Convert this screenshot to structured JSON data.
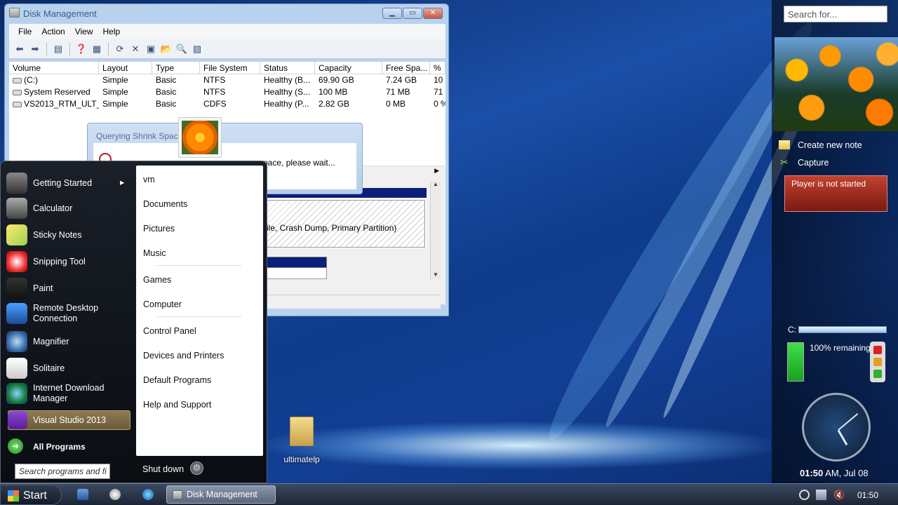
{
  "disk_management": {
    "title": "Disk Management",
    "controls": {
      "minimize": "▁",
      "maximize": "▭",
      "close": "✕"
    },
    "menu": [
      "File",
      "Action",
      "View",
      "Help"
    ],
    "columns": [
      "Volume",
      "Layout",
      "Type",
      "File System",
      "Status",
      "Capacity",
      "Free Spa...",
      "%"
    ],
    "rows": [
      {
        "volume": "(C:)",
        "layout": "Simple",
        "type": "Basic",
        "fs": "NTFS",
        "status": "Healthy (B...",
        "capacity": "69.90 GB",
        "free": "7.24 GB",
        "pct": "10"
      },
      {
        "volume": "System Reserved",
        "layout": "Simple",
        "type": "Basic",
        "fs": "NTFS",
        "status": "Healthy (S...",
        "capacity": "100 MB",
        "free": "71 MB",
        "pct": "71"
      },
      {
        "volume": "VS2013_RTM_ULT_...",
        "layout": "Simple",
        "type": "Basic",
        "fs": "CDFS",
        "status": "Healthy (P...",
        "capacity": "2.82 GB",
        "free": "0 MB",
        "pct": "0 %"
      }
    ],
    "partition_text": "ile, Crash Dump, Primary Partition)"
  },
  "shrink_dialog": {
    "title": "Querying Shrink Space",
    "message": "pace, please wait..."
  },
  "start_menu": {
    "programs": [
      {
        "label": "Getting Started",
        "arrow": "▸"
      },
      {
        "label": "Calculator"
      },
      {
        "label": "Sticky Notes"
      },
      {
        "label": "Snipping Tool"
      },
      {
        "label": "Paint"
      },
      {
        "label": "Remote Desktop",
        "label2": "Connection"
      },
      {
        "label": "Magnifier"
      },
      {
        "label": "Solitaire"
      },
      {
        "label": "Internet Download",
        "label2": "Manager"
      },
      {
        "label": "Visual Studio 2013"
      }
    ],
    "all_programs": "All Programs",
    "all_programs_icon": "➜",
    "search_placeholder": "Search programs and fi",
    "places": [
      "vm",
      "Documents",
      "Pictures",
      "Music",
      "Games",
      "Computer",
      "Control Panel",
      "Devices and Printers",
      "Default Programs",
      "Help and Support"
    ],
    "shutdown": "Shut down",
    "power_icon": "⏻"
  },
  "desktop": {
    "icon_label": "ultimatelp"
  },
  "sidebar": {
    "search_placeholder": "Search for...",
    "notes": [
      "Create new note",
      "Capture"
    ],
    "player_status": "Player is not started",
    "drive_label": "C:",
    "battery_text": "100% remaining"
  },
  "taskbar": {
    "start_label": "Start",
    "task_label": "Disk Management",
    "clock": "01:50"
  },
  "clock_gadget": {
    "time": "01:50",
    "ampm_date": "AM, Jul 08"
  }
}
